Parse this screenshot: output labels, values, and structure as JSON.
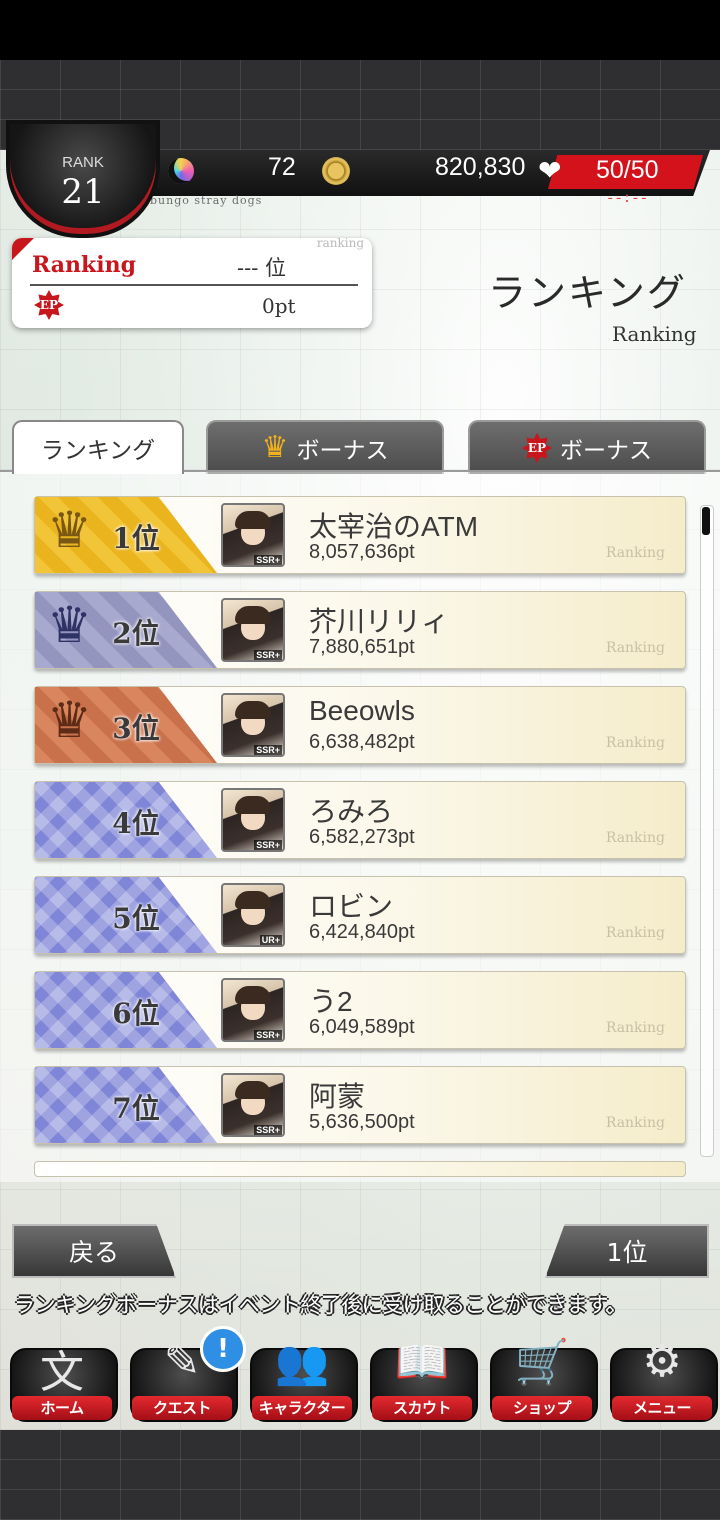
{
  "header": {
    "rank_label": "RANK",
    "rank_value": "21",
    "subtitle": "bungo stray dogs",
    "gems": "72",
    "gems_icon": "moon-gem-icon",
    "coins": "820,830",
    "coins_icon": "gold-coin-icon",
    "ap": "50/50",
    "ap_icon": "heart-icon",
    "ap_timer": "--:--"
  },
  "ranking_card": {
    "title": "Ranking",
    "tag": "ranking",
    "place": "--- 位",
    "ep_icon": "ep-badge-icon",
    "ep_label": "EP",
    "points": "0pt"
  },
  "page": {
    "title": "ランキング",
    "subtitle": "Ranking"
  },
  "tabs": [
    {
      "label": "ランキング",
      "active": true
    },
    {
      "label": "ボーナス",
      "icon": "crown-icon"
    },
    {
      "label": "ボーナス",
      "icon": "ep-badge-icon",
      "icon_text": "EP"
    }
  ],
  "rankings": [
    {
      "rank": "1位",
      "name": "太宰治のATM",
      "score": "8,057,636pt",
      "rarity": "SSR+",
      "tier": "gold",
      "tag": "Ranking"
    },
    {
      "rank": "2位",
      "name": "芥川リリィ",
      "score": "7,880,651pt",
      "rarity": "SSR+",
      "tier": "silver",
      "tag": "Ranking"
    },
    {
      "rank": "3位",
      "name": "Beeowls",
      "score": "6,638,482pt",
      "rarity": "SSR+",
      "tier": "bronze",
      "tag": "Ranking"
    },
    {
      "rank": "4位",
      "name": "ろみろ",
      "score": "6,582,273pt",
      "rarity": "SSR+",
      "tier": "blue",
      "tag": "Ranking"
    },
    {
      "rank": "5位",
      "name": "ロビン",
      "score": "6,424,840pt",
      "rarity": "UR+",
      "tier": "blue",
      "tag": "Ranking"
    },
    {
      "rank": "6位",
      "name": "う2",
      "score": "6,049,589pt",
      "rarity": "SSR+",
      "tier": "blue",
      "tag": "Ranking"
    },
    {
      "rank": "7位",
      "name": "阿蒙",
      "score": "5,636,500pt",
      "rarity": "SSR+",
      "tier": "blue",
      "tag": "Ranking"
    }
  ],
  "buttons": {
    "back": "戻る",
    "jump_rank": "1位"
  },
  "notice": "ランキングボーナスはイベント終了後に受け取ることができます。",
  "nav": [
    {
      "label": "ホーム",
      "icon": "home-bungo-icon",
      "glyph": "文"
    },
    {
      "label": "クエスト",
      "icon": "quest-icon",
      "glyph": "✎"
    },
    {
      "label": "キャラクター",
      "icon": "characters-icon",
      "glyph": "👥"
    },
    {
      "label": "スカウト",
      "icon": "scout-book-icon",
      "glyph": "📖"
    },
    {
      "label": "ショップ",
      "icon": "shop-cart-icon",
      "glyph": "🛒"
    },
    {
      "label": "メニュー",
      "icon": "menu-gear-icon",
      "glyph": "⚙"
    }
  ],
  "nav_alert": "!",
  "colors": {
    "accent_red": "#c8161d",
    "gold": "#f2c437",
    "silver": "#a8a9cf",
    "bronze": "#d9855e",
    "blue": "#7f86d7"
  }
}
